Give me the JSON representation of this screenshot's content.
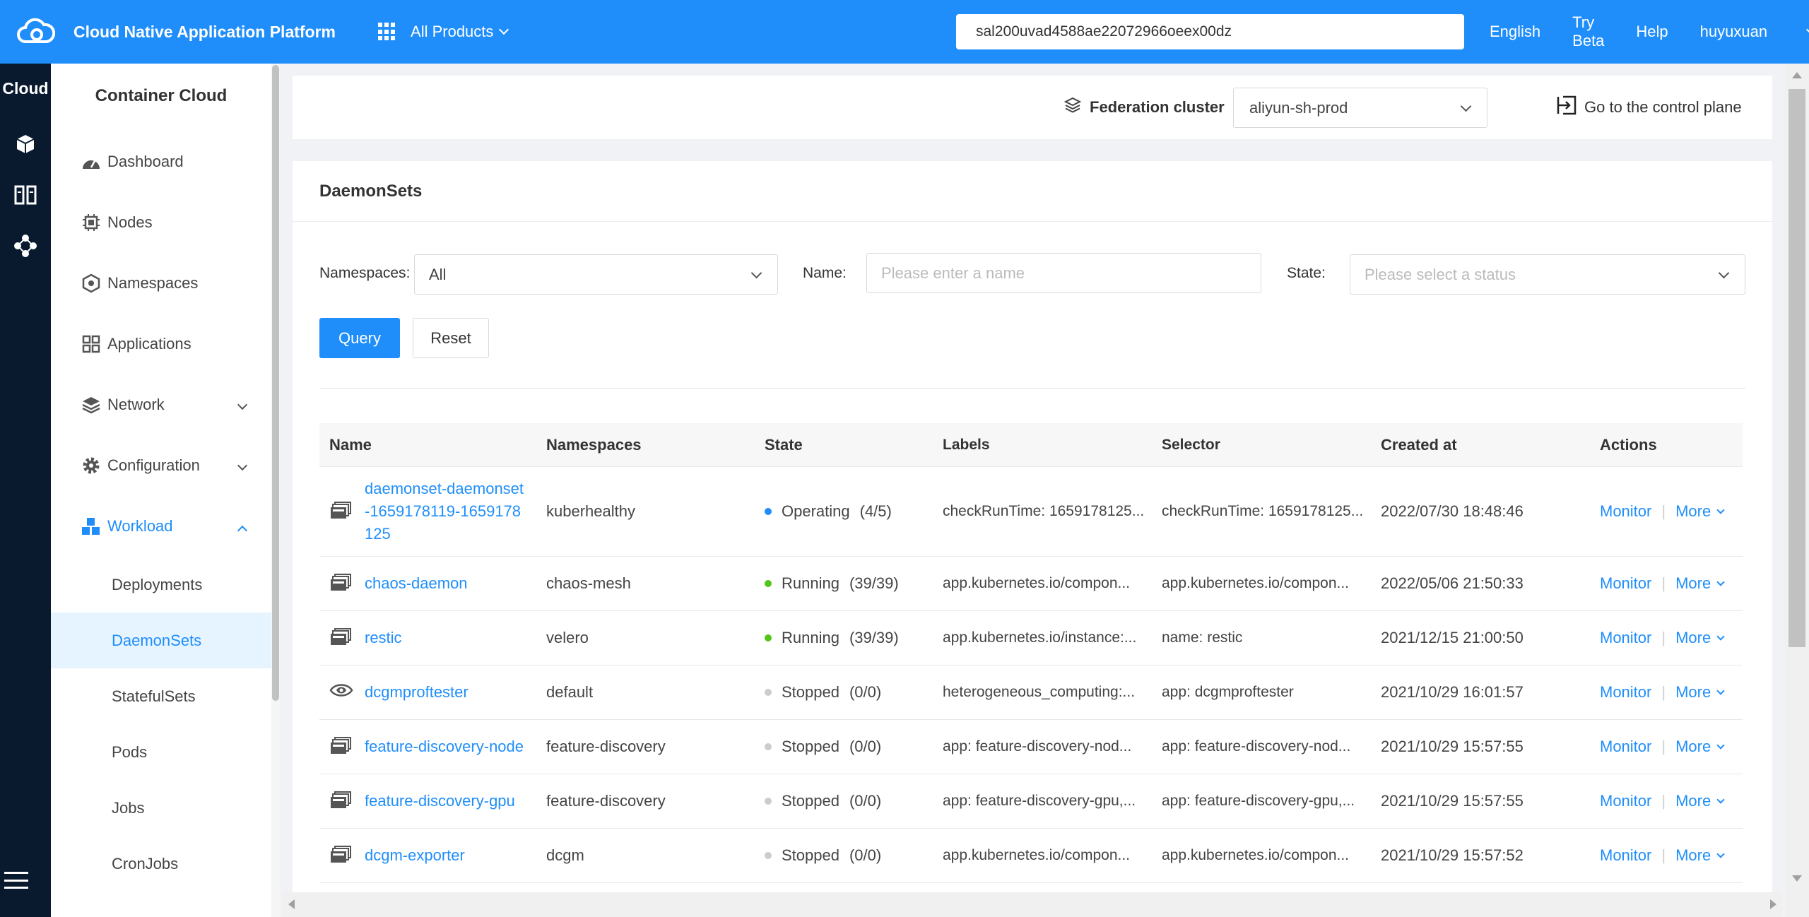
{
  "topbar": {
    "app_title": "Cloud Native Application Platform",
    "products_label": "All Products",
    "search_value": "sal200uvad4588ae22072966oeex00dz",
    "links": {
      "language": "English",
      "try_beta": "Try Beta",
      "help": "Help",
      "user": "huyuxuan"
    },
    "bg_color": "#1f8efa"
  },
  "rail": {
    "title": "Cloud"
  },
  "sidebar": {
    "title": "Container Cloud",
    "items": [
      {
        "label": "Dashboard",
        "icon": "dashboard-icon"
      },
      {
        "label": "Nodes",
        "icon": "chip-icon"
      },
      {
        "label": "Namespaces",
        "icon": "hexagon-icon"
      },
      {
        "label": "Applications",
        "icon": "apps-grid-icon"
      },
      {
        "label": "Network",
        "icon": "layers-icon"
      },
      {
        "label": "Configuration",
        "icon": "gear-icon"
      },
      {
        "label": "Workload",
        "icon": "cubes-icon"
      }
    ],
    "workload_children": [
      "Deployments",
      "DaemonSets",
      "StatefulSets",
      "Pods",
      "Jobs",
      "CronJobs"
    ],
    "active": "DaemonSets"
  },
  "federation": {
    "label": "Federation cluster",
    "selected": "aliyun-sh-prod",
    "go_control_plane": "Go to the control plane"
  },
  "page": {
    "title": "DaemonSets",
    "filters": {
      "namespaces_label": "Namespaces",
      "namespaces_value": "All",
      "name_label": "Name",
      "name_placeholder": "Please enter a name",
      "state_label": "State",
      "state_placeholder": "Please select a status"
    },
    "query_label": "Query",
    "reset_label": "Reset"
  },
  "table": {
    "columns": [
      "Name",
      "Namespaces",
      "State",
      "Labels",
      "Selector",
      "Created at",
      "Actions"
    ],
    "rows": [
      {
        "name": "daemonset-daemonset-1659178119-1659178125",
        "name_lines": [
          "daemonset-daemonset",
          "-1659178119-1659178",
          "125"
        ],
        "namespace": "kuberhealthy",
        "state": "Operating",
        "count": "(4/5)",
        "state_color": "#1f8efa",
        "labels": "checkRunTime: 1659178125...",
        "selector": "checkRunTime: 1659178125...",
        "created": "2022/07/30 18:48:46",
        "icon": "daemonset-icon"
      },
      {
        "name": "chaos-daemon",
        "name_lines": [
          "chaos-daemon"
        ],
        "namespace": "chaos-mesh",
        "state": "Running",
        "count": "(39/39)",
        "state_color": "#52c41a",
        "labels": "app.kubernetes.io/compon...",
        "selector": "app.kubernetes.io/compon...",
        "created": "2022/05/06 21:50:33",
        "icon": "daemonset-icon"
      },
      {
        "name": "restic",
        "name_lines": [
          "restic"
        ],
        "namespace": "velero",
        "state": "Running",
        "count": "(39/39)",
        "state_color": "#52c41a",
        "labels": "app.kubernetes.io/instance:...",
        "selector": "name: restic",
        "created": "2021/12/15 21:00:50",
        "icon": "daemonset-icon"
      },
      {
        "name": "dcgmproftester",
        "name_lines": [
          "dcgmproftester"
        ],
        "namespace": "default",
        "state": "Stopped",
        "count": "(0/0)",
        "state_color": "#cccccc",
        "labels": "heterogeneous_computing:...",
        "selector": "app: dcgmproftester",
        "created": "2021/10/29 16:01:57",
        "icon": "nvidia-icon"
      },
      {
        "name": "feature-discovery-node",
        "name_lines": [
          "feature-discovery-node"
        ],
        "namespace": "feature-discovery",
        "state": "Stopped",
        "count": "(0/0)",
        "state_color": "#cccccc",
        "labels": "app: feature-discovery-nod...",
        "selector": "app: feature-discovery-nod...",
        "created": "2021/10/29 15:57:55",
        "icon": "daemonset-icon"
      },
      {
        "name": "feature-discovery-gpu",
        "name_lines": [
          "feature-discovery-gpu"
        ],
        "namespace": "feature-discovery",
        "state": "Stopped",
        "count": "(0/0)",
        "state_color": "#cccccc",
        "labels": "app: feature-discovery-gpu,...",
        "selector": "app: feature-discovery-gpu,...",
        "created": "2021/10/29 15:57:55",
        "icon": "daemonset-icon"
      },
      {
        "name": "dcgm-exporter",
        "name_lines": [
          "dcgm-exporter"
        ],
        "namespace": "dcgm",
        "state": "Stopped",
        "count": "(0/0)",
        "state_color": "#cccccc",
        "labels": "app.kubernetes.io/compon...",
        "selector": "app.kubernetes.io/compon...",
        "created": "2021/10/29 15:57:52",
        "icon": "daemonset-icon"
      }
    ],
    "monitor_label": "Monitor",
    "more_label": "More"
  }
}
